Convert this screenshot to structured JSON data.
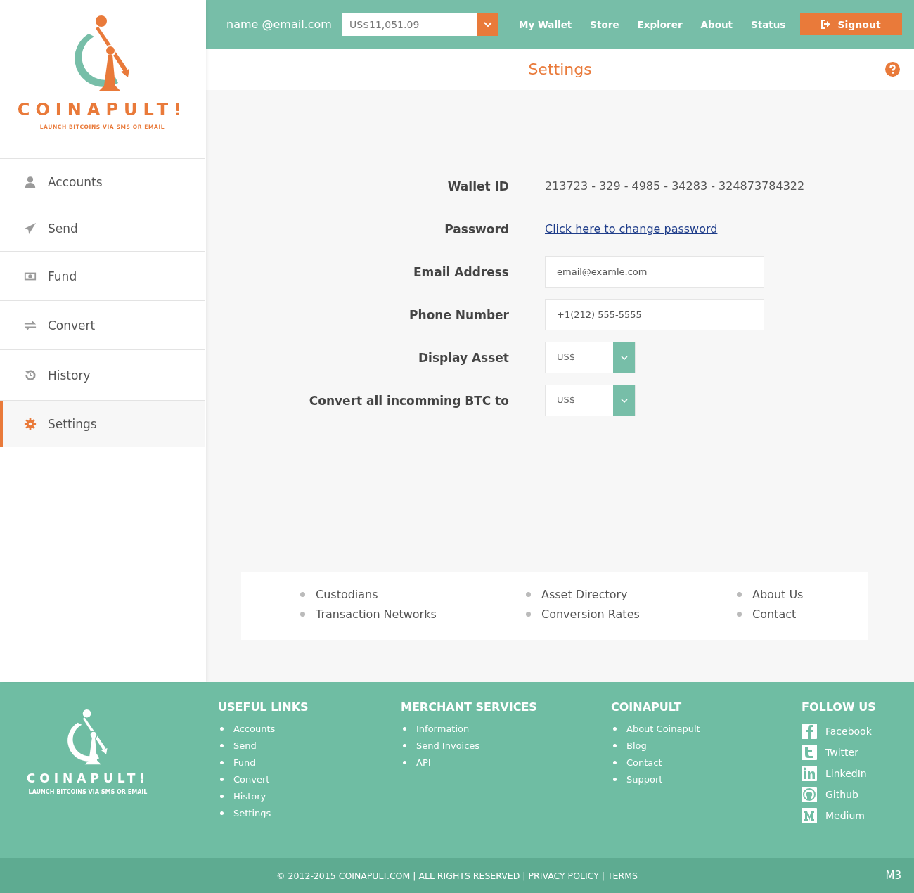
{
  "brand": {
    "name": "COINAPULT!",
    "tagline": "LAUNCH BITCOINS VIA SMS OR EMAIL"
  },
  "sidebar": {
    "items": [
      {
        "label": "Accounts",
        "kind": "user",
        "selected": false
      },
      {
        "label": "Send",
        "kind": "send",
        "selected": false
      },
      {
        "label": "Fund",
        "kind": "money",
        "selected": false
      },
      {
        "label": "Convert",
        "kind": "exchange",
        "selected": false
      },
      {
        "label": "History",
        "kind": "history",
        "selected": false
      },
      {
        "label": "Settings",
        "kind": "gear",
        "selected": true
      }
    ]
  },
  "topbar": {
    "user": "name @email.com",
    "balance": "US$11,051.09",
    "nav": [
      "My Wallet",
      "Store",
      "Explorer",
      "About",
      "Status"
    ],
    "signout": "Signout"
  },
  "page_title": "Settings",
  "form": [
    {
      "label": "Wallet ID",
      "kind": "text",
      "value": "213723 - 329 - 4985 - 34283 - 324873784322"
    },
    {
      "label": "Password",
      "kind": "link",
      "value": "Click here to change password"
    },
    {
      "label": "Email Address",
      "kind": "input",
      "value": "email@examle.com"
    },
    {
      "label": "Phone Number",
      "kind": "input",
      "value": "+1(212) 555-5555"
    },
    {
      "label": "Display Asset",
      "kind": "select",
      "value": "US$"
    },
    {
      "label": "Convert all incomming BTC to",
      "kind": "select",
      "value": "US$"
    }
  ],
  "links": [
    [
      "Custodians",
      "Transaction Networks"
    ],
    [
      "Asset Directory",
      "Conversion Rates"
    ],
    [
      "About Us",
      "Contact"
    ]
  ],
  "footer": {
    "brand": {
      "name": "COINAPULT!",
      "tagline": "LAUNCH BITCOINS VIA SMS OR EMAIL"
    },
    "columns": [
      {
        "heading": "USEFUL LINKS",
        "items": [
          "Accounts",
          "Send",
          "Fund",
          "Convert",
          "History",
          "Settings"
        ]
      },
      {
        "heading": "MERCHANT SERVICES",
        "items": [
          "Information",
          "Send Invoices",
          "API"
        ]
      },
      {
        "heading": "COINAPULT",
        "items": [
          "About Coinapult",
          "Blog",
          "Contact",
          "Support"
        ]
      }
    ],
    "follow": {
      "heading": "FOLLOW US",
      "items": [
        {
          "label": "Facebook",
          "kind": "facebook"
        },
        {
          "label": "Twitter",
          "kind": "twitter"
        },
        {
          "label": "LinkedIn",
          "kind": "linkedin"
        },
        {
          "label": "Github",
          "kind": "github"
        },
        {
          "label": "Medium",
          "kind": "medium"
        }
      ]
    },
    "copyright": "© 2012-2015 COINAPULT.COM | ALL RIGHTS RESERVED | PRIVACY POLICY | TERMS",
    "version": "M3"
  }
}
